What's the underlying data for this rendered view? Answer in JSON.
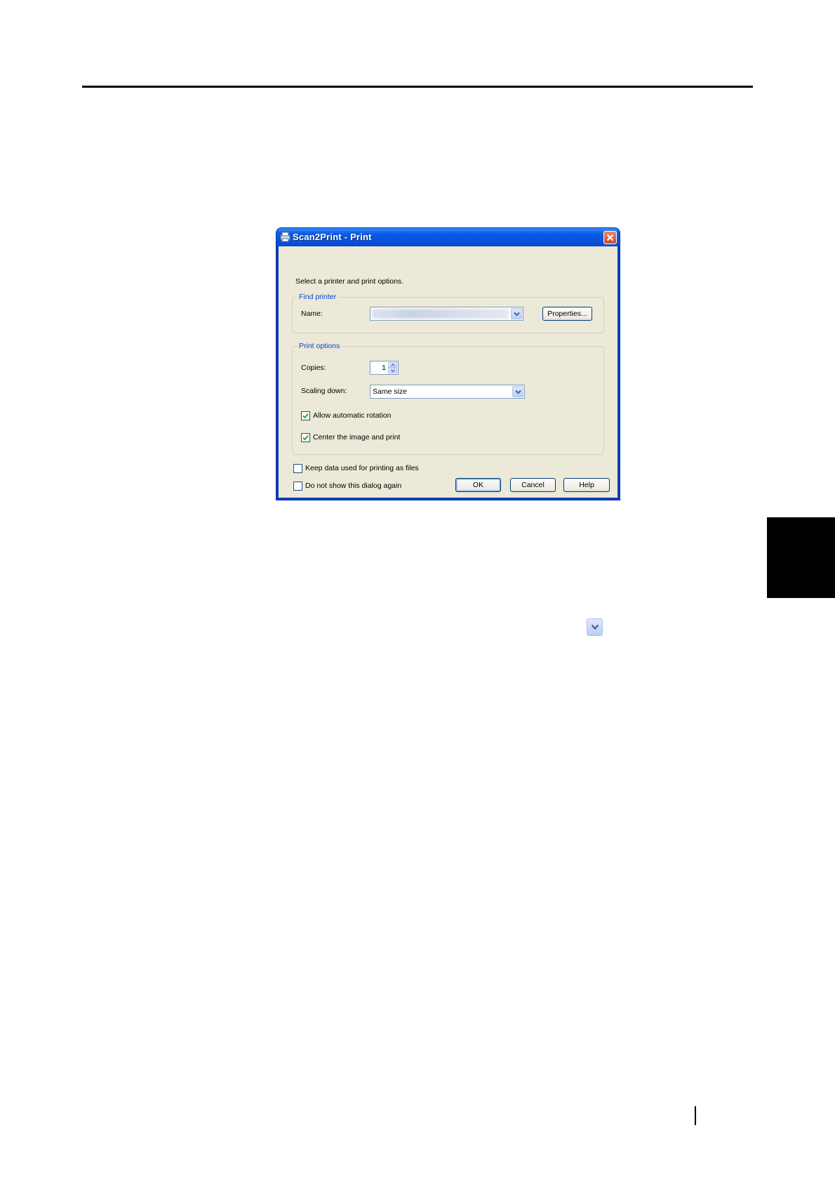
{
  "dialog": {
    "title": "Scan2Print - Print",
    "instruction": "Select a printer and print options.",
    "find_printer": {
      "group_label": "Find printer",
      "name_label": "Name:",
      "printer_name": "",
      "properties_button": "Properties..."
    },
    "print_options": {
      "group_label": "Print options",
      "copies_label": "Copies:",
      "copies_value": "1",
      "scaling_label": "Scaling down:",
      "scaling_value": "Same size",
      "allow_rotation_label": "Allow automatic rotation",
      "allow_rotation_checked": true,
      "center_image_label": "Center the image and print",
      "center_image_checked": true
    },
    "keep_data_label": "Keep data used for printing as files",
    "keep_data_checked": false,
    "dont_show_label": "Do not show this dialog again",
    "dont_show_checked": false,
    "ok_button": "OK",
    "cancel_button": "Cancel",
    "help_button": "Help"
  },
  "icons": {
    "title_icon": "scan2print-app-icon",
    "close": "close-icon",
    "dropdown": "chevron-down-icon"
  }
}
